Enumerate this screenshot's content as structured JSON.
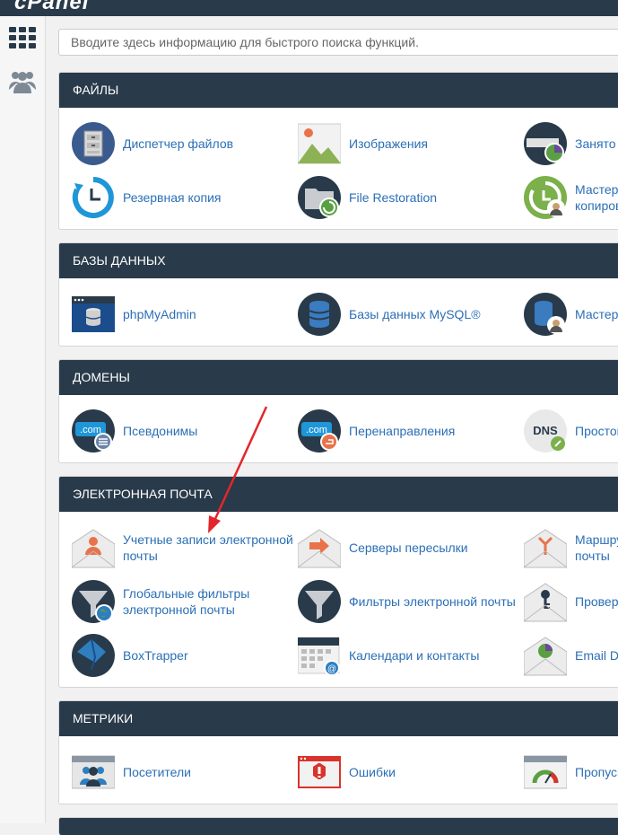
{
  "header": {
    "logo_text": "cPanel"
  },
  "search": {
    "placeholder": "Вводите здесь информацию для быстрого поиска функций."
  },
  "sections": [
    {
      "title": "ФАЙЛЫ",
      "items": [
        {
          "label": "Диспетчер файлов",
          "icon": "file-cabinet-icon"
        },
        {
          "label": "Изображения",
          "icon": "images-icon"
        },
        {
          "label": "Занято",
          "icon": "disk-usage-icon"
        },
        {
          "label": "Резервная копия",
          "icon": "backup-icon"
        },
        {
          "label": "File Restoration",
          "icon": "file-restoration-icon"
        },
        {
          "label": "Мастер копиров",
          "icon": "backup-wizard-icon"
        }
      ]
    },
    {
      "title": "БАЗЫ ДАННЫХ",
      "items": [
        {
          "label": "phpMyAdmin",
          "icon": "phpmyadmin-icon"
        },
        {
          "label": "Базы данных MySQL®",
          "icon": "mysql-database-icon"
        },
        {
          "label": "Мастер",
          "icon": "mysql-wizard-icon"
        }
      ]
    },
    {
      "title": "ДОМЕНЫ",
      "items": [
        {
          "label": "Псевдонимы",
          "icon": "aliases-icon"
        },
        {
          "label": "Перенаправления",
          "icon": "redirects-icon"
        },
        {
          "label": "Простой",
          "icon": "dns-zone-icon"
        }
      ]
    },
    {
      "title": "ЭЛЕКТРОННАЯ ПОЧТА",
      "items": [
        {
          "label": "Учетные записи электронной почты",
          "icon": "email-accounts-icon"
        },
        {
          "label": "Серверы пересылки",
          "icon": "forwarders-icon"
        },
        {
          "label": "Маршру почты",
          "icon": "email-routing-icon"
        },
        {
          "label": "Глобальные фильтры электронной почты",
          "icon": "global-filters-icon"
        },
        {
          "label": "Фильтры электронной почты",
          "icon": "email-filters-icon"
        },
        {
          "label": "Провер",
          "icon": "email-deliverability-icon"
        },
        {
          "label": "BoxTrapper",
          "icon": "boxtrapper-icon"
        },
        {
          "label": "Календари и контакты",
          "icon": "calendars-icon"
        },
        {
          "label": "Email D",
          "icon": "email-disk-usage-icon"
        }
      ]
    },
    {
      "title": "МЕТРИКИ",
      "items": [
        {
          "label": "Посетители",
          "icon": "visitors-icon"
        },
        {
          "label": "Ошибки",
          "icon": "errors-icon"
        },
        {
          "label": "Пропускн",
          "icon": "bandwidth-icon"
        }
      ]
    }
  ],
  "colors": {
    "header_bg": "#293a4a",
    "link": "#2b6fb6",
    "accent_orange": "#e8734a",
    "annotation_red": "#e3262b"
  }
}
